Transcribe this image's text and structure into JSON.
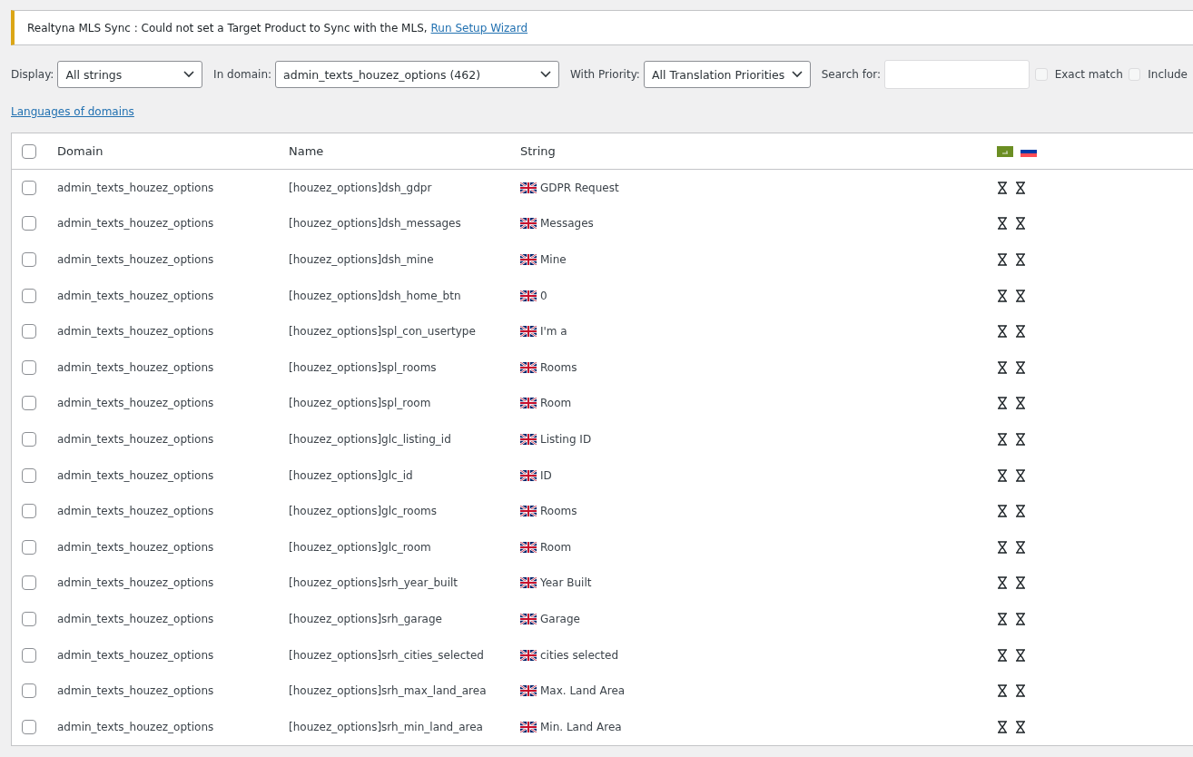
{
  "notice": {
    "text": "Realtyna MLS Sync : Could not set a Target Product to Sync with the MLS,",
    "link": "Run Setup Wizard"
  },
  "filters": {
    "display": {
      "label": "Display:",
      "value": "All strings"
    },
    "domain": {
      "label": "In domain:",
      "value": "admin_texts_houzez_options (462)"
    },
    "priority": {
      "label": "With Priority:",
      "value": "All Translation Priorities"
    },
    "search": {
      "label": "Search for:"
    },
    "options": [
      {
        "label": "Exact match",
        "checked": false
      },
      {
        "label": "Include",
        "checked": false
      }
    ]
  },
  "languages_link": "Languages of domains",
  "table": {
    "select_all": false,
    "columns": [
      "Domain",
      "Name",
      "String"
    ],
    "rows": [
      {
        "domain": "admin_texts_houzez_options",
        "name": "[houzez_options]dsh_gdpr",
        "string": "GDPR Request",
        "selected": false
      },
      {
        "domain": "admin_texts_houzez_options",
        "name": "[houzez_options]dsh_messages",
        "string": "Messages",
        "selected": false
      },
      {
        "domain": "admin_texts_houzez_options",
        "name": "[houzez_options]dsh_mine",
        "string": "Mine",
        "selected": false
      },
      {
        "domain": "admin_texts_houzez_options",
        "name": "[houzez_options]dsh_home_btn",
        "string": "0",
        "selected": false
      },
      {
        "domain": "admin_texts_houzez_options",
        "name": "[houzez_options]spl_con_usertype",
        "string": "I'm a",
        "selected": false
      },
      {
        "domain": "admin_texts_houzez_options",
        "name": "[houzez_options]spl_rooms",
        "string": "Rooms",
        "selected": false
      },
      {
        "domain": "admin_texts_houzez_options",
        "name": "[houzez_options]spl_room",
        "string": "Room",
        "selected": false
      },
      {
        "domain": "admin_texts_houzez_options",
        "name": "[houzez_options]glc_listing_id",
        "string": "Listing ID",
        "selected": false
      },
      {
        "domain": "admin_texts_houzez_options",
        "name": "[houzez_options]glc_id",
        "string": "ID",
        "selected": false
      },
      {
        "domain": "admin_texts_houzez_options",
        "name": "[houzez_options]glc_rooms",
        "string": "Rooms",
        "selected": false
      },
      {
        "domain": "admin_texts_houzez_options",
        "name": "[houzez_options]glc_room",
        "string": "Room",
        "selected": false
      },
      {
        "domain": "admin_texts_houzez_options",
        "name": "[houzez_options]srh_year_built",
        "string": "Year Built",
        "selected": false
      },
      {
        "domain": "admin_texts_houzez_options",
        "name": "[houzez_options]srh_garage",
        "string": "Garage",
        "selected": false
      },
      {
        "domain": "admin_texts_houzez_options",
        "name": "[houzez_options]srh_cities_selected",
        "string": "cities selected",
        "selected": false
      },
      {
        "domain": "admin_texts_houzez_options",
        "name": "[houzez_options]srh_max_land_area",
        "string": "Max. Land Area",
        "selected": false
      },
      {
        "domain": "admin_texts_houzez_options",
        "name": "[houzez_options]srh_min_land_area",
        "string": "Min. Land Area",
        "selected": false
      }
    ]
  }
}
